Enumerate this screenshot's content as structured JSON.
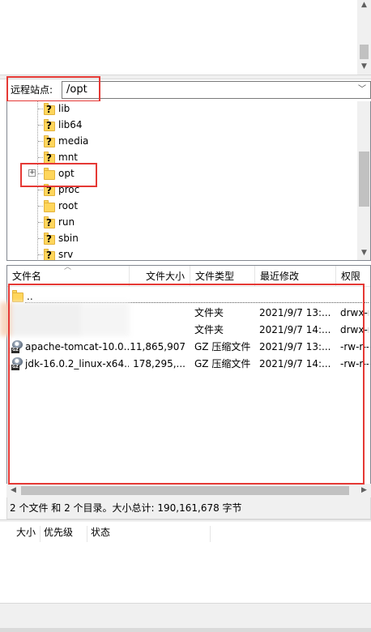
{
  "remote_site": {
    "label": "远程站点:",
    "path": "/opt"
  },
  "tree": {
    "items": [
      {
        "label": "lib",
        "unknown": true
      },
      {
        "label": "lib64",
        "unknown": true
      },
      {
        "label": "media",
        "unknown": true
      },
      {
        "label": "mnt",
        "unknown": true
      },
      {
        "label": "opt",
        "unknown": false,
        "expandable": true
      },
      {
        "label": "proc",
        "unknown": true
      },
      {
        "label": "root",
        "unknown": false
      },
      {
        "label": "run",
        "unknown": true
      },
      {
        "label": "sbin",
        "unknown": true
      },
      {
        "label": "srv",
        "unknown": true
      }
    ]
  },
  "filelist": {
    "columns": {
      "name": "文件名",
      "size": "文件大小",
      "type": "文件类型",
      "modified": "最近修改",
      "perms": "权限"
    },
    "parent_label": "..",
    "rows": [
      {
        "name": "",
        "size": "",
        "type": "文件夹",
        "modified": "2021/9/7 13:...",
        "perms": "drwx-r-"
      },
      {
        "name": "",
        "size": "",
        "type": "文件夹",
        "modified": "2021/9/7 14:...",
        "perms": "drwx-r-"
      },
      {
        "name": "apache-tomcat-10.0...",
        "size": "11,865,907",
        "type": "GZ 压缩文件",
        "modified": "2021/9/7 13:...",
        "perms": "-rw-r--"
      },
      {
        "name": "jdk-16.0.2_linux-x64...",
        "size": "178,295,...",
        "type": "GZ 压缩文件",
        "modified": "2021/9/7 14:...",
        "perms": "-rw-r--"
      }
    ]
  },
  "status": {
    "text": "2 个文件 和 2 个目录。大小总计: 190,161,678 字节"
  },
  "queue": {
    "columns": [
      "大小",
      "优先级",
      "状态"
    ]
  },
  "colors": {
    "highlight": "#e53935",
    "folder": "#ffd65c"
  }
}
